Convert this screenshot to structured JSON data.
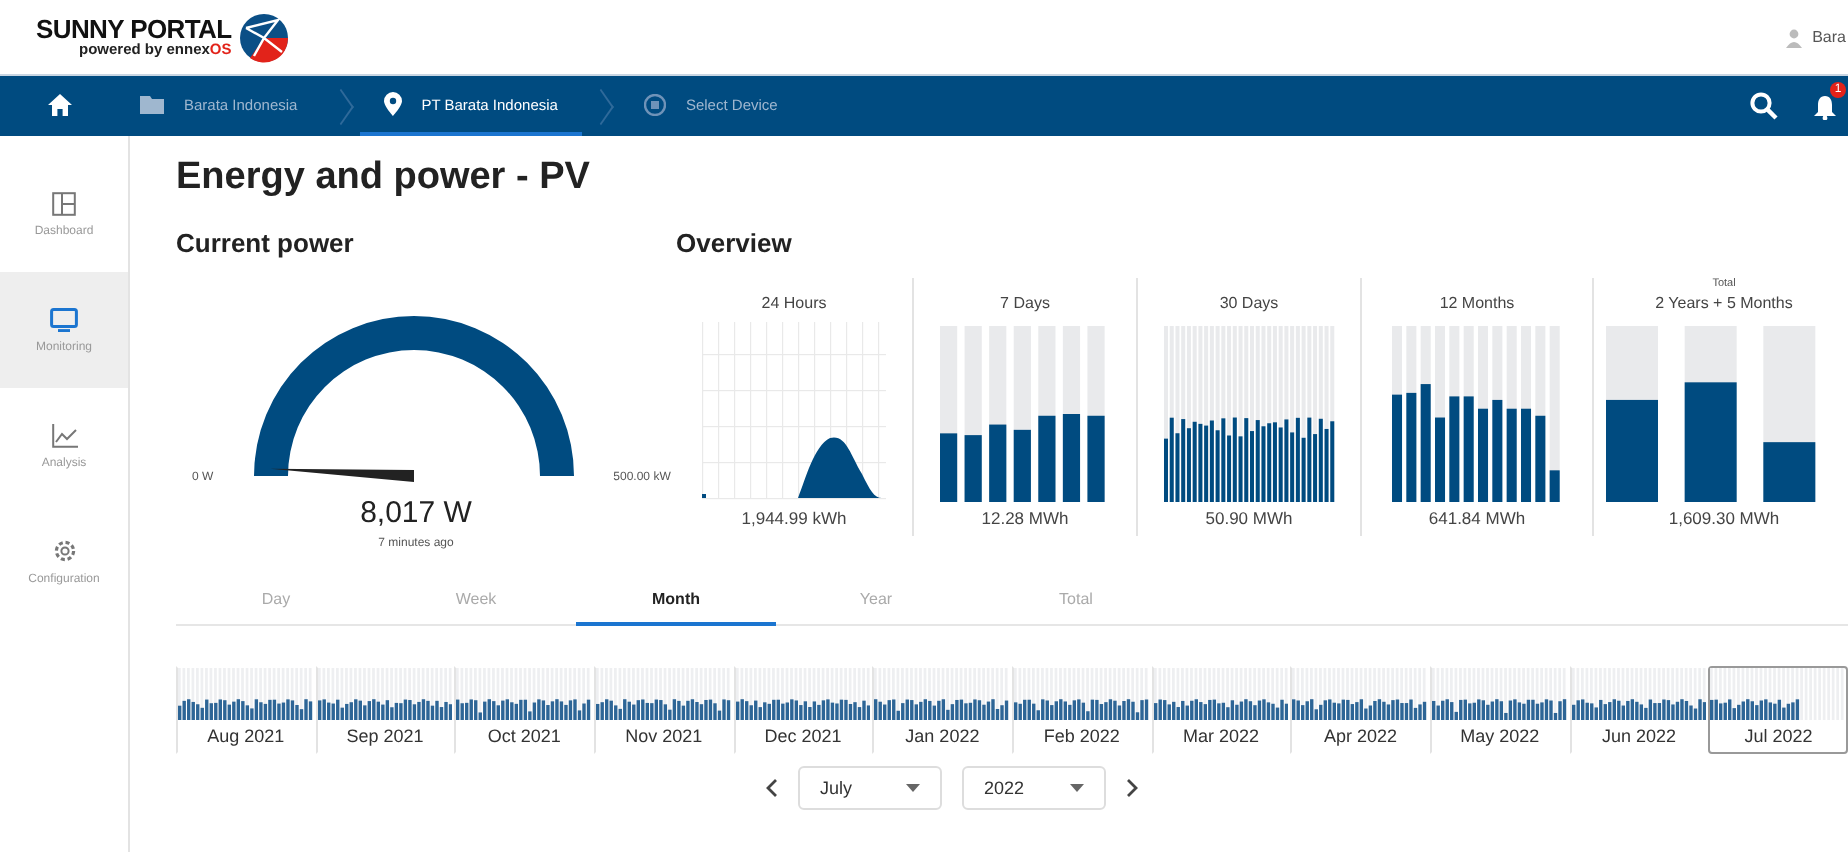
{
  "logo": {
    "title": "SUNNY PORTAL",
    "subtitle": "powered by ennex",
    "subtitle_accent": "OS"
  },
  "user": {
    "name": "Bara"
  },
  "breadcrumbs": [
    {
      "kind": "home",
      "selected": false
    },
    {
      "kind": "folder",
      "label": "Barata Indonesia",
      "selected": false
    },
    {
      "kind": "pin",
      "label": "PT Barata Indonesia",
      "selected": true
    },
    {
      "kind": "device",
      "label": "Select Device",
      "selected": false
    }
  ],
  "notifications": {
    "badge": "1"
  },
  "sidebar": {
    "items": [
      {
        "kind": "dashboard",
        "label": "Dashboard",
        "selected": false
      },
      {
        "kind": "monitoring",
        "label": "Monitoring",
        "selected": true
      },
      {
        "kind": "analysis",
        "label": "Analysis",
        "selected": false
      },
      {
        "kind": "configuration",
        "label": "Configuration",
        "selected": false
      }
    ]
  },
  "page": {
    "title": "Energy and power - PV"
  },
  "current_power": {
    "title": "Current power",
    "min_label": "0 W",
    "max_label": "500.00 kW",
    "value": "8,017 W",
    "updated": "7 minutes ago"
  },
  "overview": {
    "title": "Overview",
    "panels": [
      {
        "kind": "area",
        "label": "24 Hours",
        "total": "1,944.99 kWh"
      },
      {
        "kind": "bars",
        "label": "7 Days",
        "total": "12.28 MWh"
      },
      {
        "kind": "bars",
        "label": "30 Days",
        "total": "50.90 MWh"
      },
      {
        "kind": "bars",
        "label": "12 Months",
        "total": "641.84 MWh"
      },
      {
        "kind": "bars",
        "caption": "Total",
        "label": "2 Years + 5 Months",
        "total": "1,609.30 MWh"
      }
    ]
  },
  "period_tabs": [
    {
      "label": "Day",
      "selected": false
    },
    {
      "label": "Week",
      "selected": false
    },
    {
      "label": "Month",
      "selected": true
    },
    {
      "label": "Year",
      "selected": false
    },
    {
      "label": "Total",
      "selected": false
    }
  ],
  "timeline": {
    "months": [
      {
        "label": "Aug 2021",
        "selected": false
      },
      {
        "label": "Sep 2021",
        "selected": false
      },
      {
        "label": "Oct 2021",
        "selected": false
      },
      {
        "label": "Nov 2021",
        "selected": false
      },
      {
        "label": "Dec 2021",
        "selected": false
      },
      {
        "label": "Jan 2022",
        "selected": false
      },
      {
        "label": "Feb 2022",
        "selected": false
      },
      {
        "label": "Mar 2022",
        "selected": false
      },
      {
        "label": "Apr 2022",
        "selected": false
      },
      {
        "label": "May 2022",
        "selected": false
      },
      {
        "label": "Jun 2022",
        "selected": false
      },
      {
        "label": "Jul 2022",
        "selected": true
      }
    ]
  },
  "selectors": {
    "month": "July",
    "year": "2022"
  }
}
